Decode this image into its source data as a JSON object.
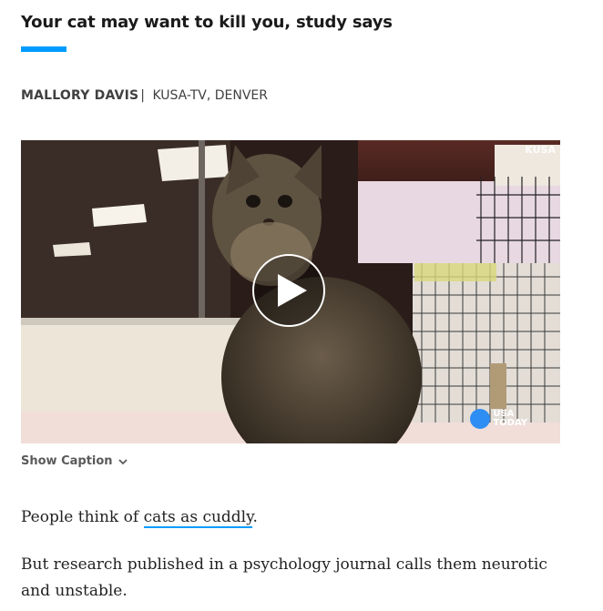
{
  "article": {
    "headline": "Your cat may want to kill you, study says",
    "author": "MALLORY DAVIS",
    "separator": "|",
    "outlet": "KUSA-TV, DENVER"
  },
  "video": {
    "watermark": "KUSA",
    "logo_line1": "USA",
    "logo_line2": "TODAY",
    "play_icon": "play-icon",
    "accent": "#2f8ef3"
  },
  "caption": {
    "toggle_label": "Show Caption",
    "toggle_icon": "chevron-down-icon"
  },
  "body": {
    "p1_before": "People think of ",
    "p1_link": "cats as cuddly",
    "p1_after": ".",
    "p2": "But research published in a psychology journal calls them neurotic and unstable."
  },
  "colors": {
    "accent_rule": "#009bff",
    "text": "#222222"
  }
}
